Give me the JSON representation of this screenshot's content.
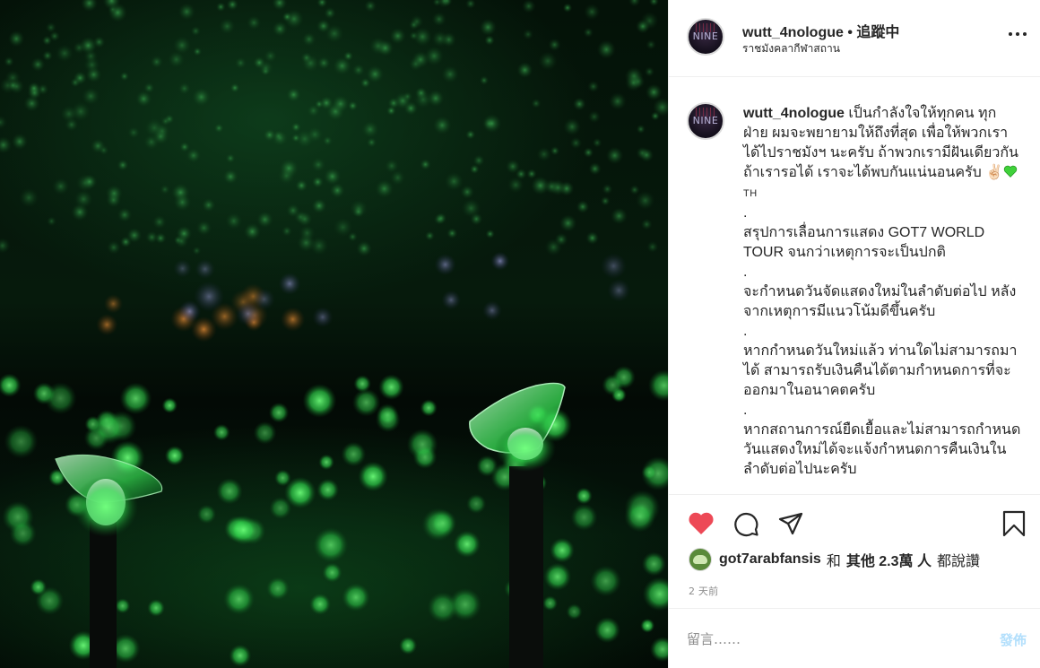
{
  "photo": {
    "alt_name": "green-lightstick-concert-photo"
  },
  "header": {
    "avatar_text": "NINE",
    "username": "wutt_4nologue",
    "separator": " • ",
    "follow_status": "追蹤中",
    "location": "ราชมังคลากีฬาสถาน"
  },
  "caption": {
    "avatar_text": "NINE",
    "username": "wutt_4nologue",
    "line1": " เป็นกำลังใจให้ทุกคน ทุกฝ่าย ผมจะพยายามให้ถึงที่สุด เพื่อให้พวกเราได้ไปราชมังฯ นะครับ ถ้าพวกเรามีฝันเดียวกัน ถ้าเรารอได้ เราจะได้พบกันแน่นอนครับ ",
    "emoji_hand": "✌🏻",
    "th_tag": "TH",
    "dot": ".",
    "para2": "สรุปการเลื่อนการแสดง GOT7 WORLD TOUR จนกว่าเหตุการจะเป็นปกติ",
    "para3": "จะกำหนดวันจัดแสดงใหม่ในลำดับต่อไป หลังจากเหตุการมีแนวโน้มดีขึ้นครับ",
    "para4": "หากกำหนดวันใหม่แล้ว ท่านใดไม่สามารถมาได้ สามารถรับเงินคืนได้ตามกำหนดการที่จะออกมาในอนาคตครับ",
    "para5": "หากสถานการณ์ยืดเยื้อและไม่สามารถกำหนดวันแสดงใหม่ได้จะแจ้งกำหนดการคืนเงินในลำดับต่อไปนะครับ"
  },
  "actions": {
    "like_icon": "heart-icon",
    "comment_icon": "comment-icon",
    "share_icon": "paper-plane-icon",
    "save_icon": "bookmark-icon",
    "like_color": "#ed4956"
  },
  "likes": {
    "user": "got7arabfansis",
    "connector": "和",
    "others": "其他 2.3萬 人",
    "suffix": "都說讚"
  },
  "timestamp": "2 天前",
  "comment": {
    "placeholder": "留言……",
    "post_label": "發佈"
  },
  "colors": {
    "accent_disabled": "#b2dffc",
    "text": "#262626",
    "muted": "#8e8e8e",
    "photo_glow": "#39ff5a"
  }
}
